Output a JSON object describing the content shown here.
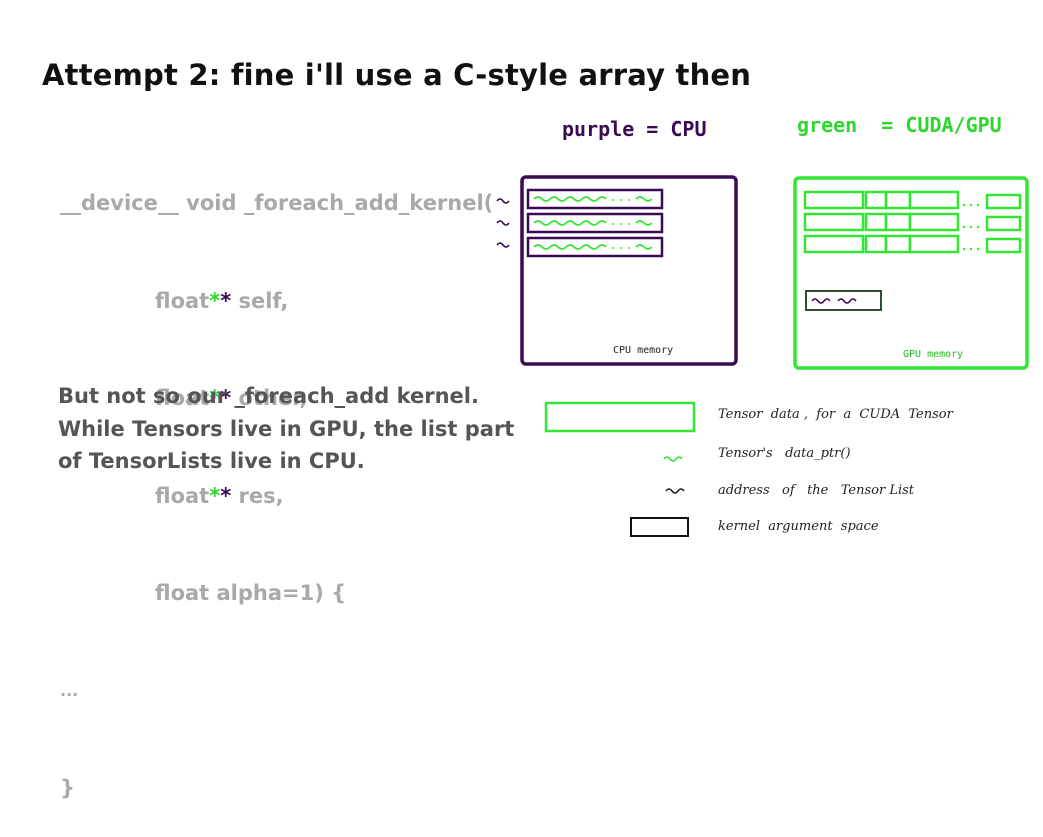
{
  "title": "Attempt 2: fine i'll use a C-style array then",
  "code": {
    "line1": "__device__ void _foreach_add_kernel(",
    "param1_type": "float",
    "param1_name": " self,",
    "param2_type": "float",
    "param2_name": " other,",
    "param3_type": "float",
    "param3_name": " res,",
    "param4": "float alpha=1) {",
    "ellipsis": "...",
    "close": "}",
    "stars": "**"
  },
  "paragraph": {
    "line1": "But not so our _foreach_add kernel.",
    "line2": "While Tensors live in GPU, the list part",
    "line3": "of TensorLists live in CPU."
  },
  "diagram": {
    "cpu_label": "purple = CPU",
    "gpu_label": "green  = CUDA/GPU",
    "cpu_memory_label": "CPU memory",
    "gpu_memory_label": "GPU memory",
    "colors": {
      "cpu": "#3a0a55",
      "gpu": "#33e633",
      "text": "#222222"
    }
  },
  "legend": {
    "tensor_data": "Tensor  data ,  for  a  CUDA  Tensor",
    "data_ptr": "Tensor's   data_ptr()",
    "list_address": "address   of   the   Tensor List",
    "kernel_arg": "kernel  argument  space"
  }
}
